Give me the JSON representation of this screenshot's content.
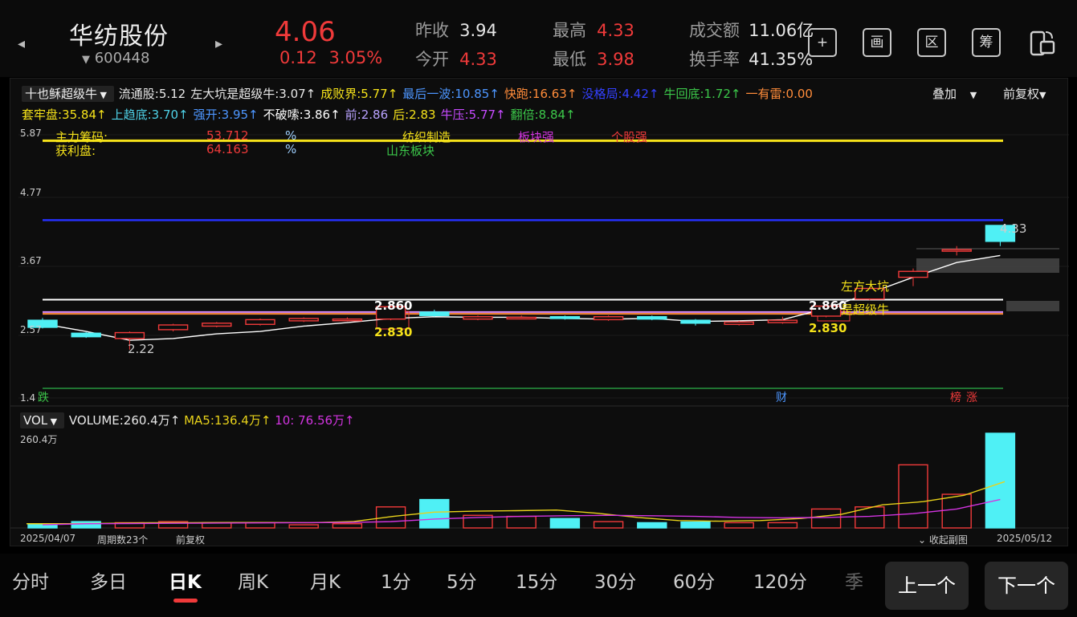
{
  "header": {
    "name": "华纺股份",
    "code": "600448",
    "price": "4.06",
    "change": "0.12",
    "change_pct": "3.05%",
    "prev_close_label": "昨收",
    "prev_close": "3.94",
    "open_label": "今开",
    "open": "4.33",
    "high_label": "最高",
    "high": "4.33",
    "low_label": "最低",
    "low": "3.98",
    "amount_label": "成交额",
    "amount": "11.06亿",
    "turnover_label": "换手率",
    "turnover": "41.35%"
  },
  "toolbar": {
    "add": "+",
    "draw": "画",
    "zone": "区",
    "chip": "筹"
  },
  "indicator": {
    "selector": "十也稣超级牛",
    "row1": [
      {
        "text": "流通股:5.12",
        "color": "#e8e8e8"
      },
      {
        "text": "左大坑是超级牛:3.07↑",
        "color": "#e8e8e8"
      },
      {
        "text": "成败界:5.77↑",
        "color": "#f5e21a"
      },
      {
        "text": "最后一波:10.85↑",
        "color": "#4d96ff"
      },
      {
        "text": "快跑:16.63↑",
        "color": "#ff8c3a"
      },
      {
        "text": "没格局:4.42↑",
        "color": "#3340ff"
      },
      {
        "text": "牛回底:1.72↑",
        "color": "#3cc84a"
      },
      {
        "text": "一有雷:0.00",
        "color": "#ff8c3a"
      }
    ],
    "row2": [
      {
        "text": "套牢盘:35.84↑",
        "color": "#f5e21a"
      },
      {
        "text": "上趋底:3.70↑",
        "color": "#4fd2e8"
      },
      {
        "text": "强开:3.95↑",
        "color": "#4d96ff"
      },
      {
        "text": "不破嗦:3.86↑",
        "color": "#ffffff"
      },
      {
        "text": "前:2.86",
        "color": "#b9a2ff"
      },
      {
        "text": "后:2.83",
        "color": "#f5e21a"
      },
      {
        "text": "牛压:5.77↑",
        "color": "#c64bff"
      },
      {
        "text": "翻倍:8.84↑",
        "color": "#3cc84a"
      }
    ],
    "overlay": "叠加",
    "adjust": "前复权"
  },
  "overlays": {
    "main_chip": "主力筹码:",
    "main_chip_val": "53.712",
    "pct1": "%",
    "profit": "获利盘:",
    "profit_val": "64.163",
    "pct2": "%",
    "industry": "纺织制造",
    "sector_strong": "板块强",
    "stock_strong": "个股强",
    "region": "山东板块",
    "label_286_a": "2.860",
    "label_283_a": "2.830",
    "label_286_b": "2.860",
    "label_283_b": "2.830",
    "pit": "左方大坑",
    "bull": "是超级牛",
    "low_label": "2.22",
    "high_label": "4.33",
    "mark_die": "跌",
    "mark_cai": "财",
    "mark_bang": "榜",
    "mark_zhang": "涨"
  },
  "yaxis": [
    "5.87",
    "4.77",
    "3.67",
    "2.57",
    "1.4"
  ],
  "volume": {
    "selector": "VOL",
    "volume": "VOLUME:260.4万↑",
    "ma5": "MA5:136.4万↑",
    "ma10": "10: 76.56万↑",
    "top": "260.4万"
  },
  "footer": {
    "start": "2025/04/07",
    "periods": "周期数23个",
    "adj": "前复权",
    "collapse": "收起副图",
    "end": "2025/05/12"
  },
  "colors": {
    "up": "#f03a3a",
    "down": "#4ff0f5",
    "ma5": "#e8d21a",
    "ma10": "#d234e0"
  },
  "chart_data": {
    "type": "candlestick",
    "ylim": [
      1.4,
      5.87
    ],
    "candles": [
      {
        "o": 2.72,
        "c": 2.6,
        "h": 2.76,
        "l": 2.58
      },
      {
        "o": 2.5,
        "c": 2.44,
        "h": 2.52,
        "l": 2.42
      },
      {
        "o": 2.41,
        "c": 2.51,
        "h": 2.53,
        "l": 2.22
      },
      {
        "o": 2.56,
        "c": 2.64,
        "h": 2.66,
        "l": 2.53
      },
      {
        "o": 2.62,
        "c": 2.67,
        "h": 2.69,
        "l": 2.6
      },
      {
        "o": 2.65,
        "c": 2.73,
        "h": 2.75,
        "l": 2.63
      },
      {
        "o": 2.71,
        "c": 2.75,
        "h": 2.77,
        "l": 2.69
      },
      {
        "o": 2.74,
        "c": 2.74,
        "h": 2.77,
        "l": 2.7
      },
      {
        "o": 2.74,
        "c": 2.95,
        "h": 2.97,
        "l": 2.72
      },
      {
        "o": 2.86,
        "c": 2.8,
        "h": 2.9,
        "l": 2.78
      },
      {
        "o": 2.74,
        "c": 2.78,
        "h": 2.8,
        "l": 2.72
      },
      {
        "o": 2.77,
        "c": 2.77,
        "h": 2.8,
        "l": 2.74
      },
      {
        "o": 2.78,
        "c": 2.75,
        "h": 2.8,
        "l": 2.73
      },
      {
        "o": 2.73,
        "c": 2.78,
        "h": 2.8,
        "l": 2.71
      },
      {
        "o": 2.78,
        "c": 2.74,
        "h": 2.8,
        "l": 2.72
      },
      {
        "o": 2.72,
        "c": 2.67,
        "h": 2.74,
        "l": 2.63
      },
      {
        "o": 2.65,
        "c": 2.69,
        "h": 2.71,
        "l": 2.63
      },
      {
        "o": 2.68,
        "c": 2.72,
        "h": 2.78,
        "l": 2.66
      },
      {
        "o": 2.79,
        "c": 2.96,
        "h": 2.98,
        "l": 2.77
      },
      {
        "o": 3.08,
        "c": 3.26,
        "h": 3.28,
        "l": 3.06
      },
      {
        "o": 3.45,
        "c": 3.55,
        "h": 3.6,
        "l": 3.3
      },
      {
        "o": 3.91,
        "c": 3.92,
        "h": 3.98,
        "l": 3.82
      },
      {
        "o": 4.33,
        "c": 4.06,
        "h": 4.33,
        "l": 3.98
      }
    ],
    "ma_line": [
      2.66,
      2.53,
      2.38,
      2.41,
      2.49,
      2.53,
      2.62,
      2.68,
      2.75,
      2.78,
      2.77,
      2.77,
      2.75,
      2.74,
      2.75,
      2.7,
      2.71,
      2.73,
      2.92,
      3.18,
      3.45,
      3.7,
      3.82
    ],
    "levels": [
      {
        "name": "成败界",
        "value": 5.77,
        "color": "#f5e21a"
      },
      {
        "name": "没格局",
        "value": 4.42,
        "color": "#2530ff"
      },
      {
        "name": "左大坑是超级牛",
        "value": 3.07,
        "color": "#ffffff"
      },
      {
        "name": "前",
        "value": 2.86,
        "color": "#d88cff"
      },
      {
        "name": "后",
        "value": 2.83,
        "color": "#ff8c3a"
      }
    ],
    "volume": [
      0.2,
      0.3,
      0.25,
      0.3,
      0.25,
      0.25,
      0.15,
      0.2,
      1.0,
      1.35,
      0.6,
      0.55,
      0.45,
      0.3,
      0.25,
      0.28,
      0.25,
      0.25,
      0.9,
      1.0,
      3.0,
      1.6,
      4.5
    ],
    "vol_max": 4.5,
    "vol_ma5": [
      0.2,
      0.2,
      0.22,
      0.25,
      0.25,
      0.26,
      0.26,
      0.25,
      0.3,
      0.55,
      0.75,
      0.8,
      0.82,
      0.85,
      0.7,
      0.5,
      0.35,
      0.32,
      0.35,
      0.45,
      0.65,
      1.1,
      1.25,
      1.55,
      2.2
    ],
    "vol_ma10": [
      0.15,
      0.2,
      0.21,
      0.22,
      0.23,
      0.24,
      0.25,
      0.26,
      0.3,
      0.42,
      0.5,
      0.55,
      0.58,
      0.6,
      0.58,
      0.55,
      0.5,
      0.48,
      0.5,
      0.55,
      0.68,
      0.9,
      1.35
    ]
  }
}
